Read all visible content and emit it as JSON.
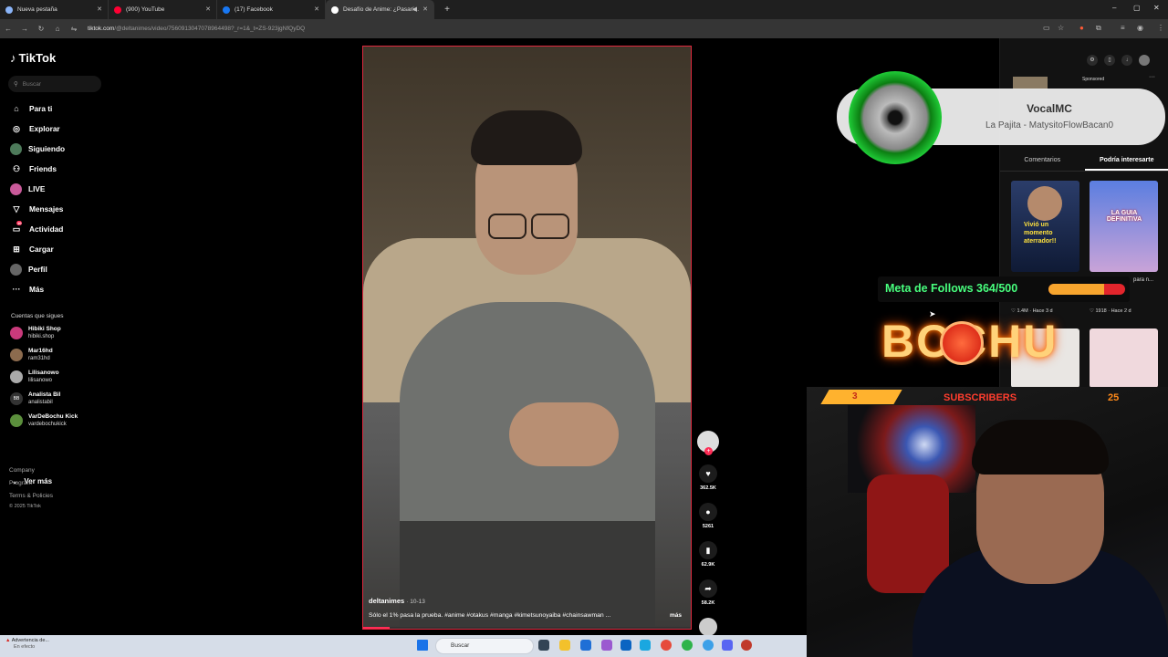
{
  "browser": {
    "tabs": [
      {
        "title": "Nueva pestaña",
        "color": "#8ab4f8",
        "active": false
      },
      {
        "title": "(900) YouTube",
        "color": "#ff0033",
        "active": false
      },
      {
        "title": "(17) Facebook",
        "color": "#1877f2",
        "active": false
      },
      {
        "title": "Desafío de Anime: ¿Pasarí...",
        "color": "#ffffff",
        "active": true
      }
    ],
    "new_tab": "+",
    "url_domain": "tiktok.com",
    "url_path": "/@deltanimes/video/7560913047078964498?_r=1&_t=ZS-923jgNfQyDQ",
    "window_controls": [
      "–",
      "▢",
      "✕"
    ]
  },
  "tiktok": {
    "logo": "TikTok",
    "search_placeholder": "Buscar",
    "nav": [
      {
        "label": "Para ti",
        "icon": "⌂"
      },
      {
        "label": "Explorar",
        "icon": "◎"
      },
      {
        "label": "Siguiendo",
        "icon": "avatar"
      },
      {
        "label": "Friends",
        "icon": "⚇"
      },
      {
        "label": "LIVE",
        "icon": "avatar"
      },
      {
        "label": "Mensajes",
        "icon": "▽"
      },
      {
        "label": "Actividad",
        "icon": "▭"
      },
      {
        "label": "Cargar",
        "icon": "⊞"
      },
      {
        "label": "Perfil",
        "icon": "avatar"
      },
      {
        "label": "Más",
        "icon": "···"
      }
    ],
    "activity_badge": "10",
    "following_title": "Cuentas que sigues",
    "following": [
      {
        "name": "Hibiki Shop",
        "handle": "hibiki.shop",
        "color": "#c93a7b"
      },
      {
        "name": "Mar16hd",
        "handle": "ram31hd",
        "color": "#8c6b4e"
      },
      {
        "name": "Lilisanowo",
        "handle": "lilisanowo",
        "color": "#aaaaaa"
      },
      {
        "name": "Analista Bil",
        "handle": "analistabil",
        "color": "#333333"
      },
      {
        "name": "VarDeBochu Kick",
        "handle": "vardebochukick",
        "color": "#5b8f3c"
      }
    ],
    "see_more": "Ver más",
    "footer": [
      "Company",
      "Program",
      "Terms & Policies",
      "© 2025 TikTok"
    ]
  },
  "video": {
    "username": "deltanimes",
    "date": "· 10-13",
    "caption": "Sólo el 1% pasa la prueba. #anime #otakus #manga #kimetsunoyaiba #chainsawman ...",
    "more": "más",
    "progress_fraction": 0.08
  },
  "actions": {
    "likes": "362.5K",
    "comments": "5261",
    "saves": "62.9K",
    "shares": "58.2K"
  },
  "right_panel": {
    "sponsored": "Sponsored",
    "tabs": [
      "Comentarios",
      "Podría interesarte"
    ],
    "thumb_texts": [
      "Vivió un momento aterrador!!",
      "LA GUIA DEFINITIVA",
      "para n..."
    ],
    "stats": [
      "♡ 1.4M · Hace 3 d",
      "♡ 1918 · Hace 2 d"
    ]
  },
  "overlay": {
    "artist": "VocalMC",
    "song": "La Pajita - MatysitoFlowBacan0",
    "goal_label": "Meta de Follows 364/500",
    "goal_fraction": 0.728,
    "bochu": "BOCHU",
    "sub_count": "3",
    "sub_label": "SUBSCRIBERS",
    "sub_goal": "25"
  },
  "taskbar": {
    "weather_title": "Advertencia de...",
    "weather_sub": "En efecto",
    "search_placeholder": "Buscar"
  }
}
